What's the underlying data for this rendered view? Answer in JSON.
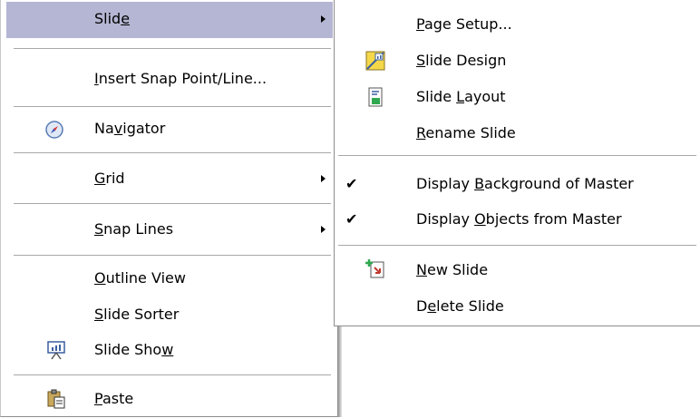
{
  "context_menu": {
    "items": [
      {
        "pre": "Slid",
        "key": "e",
        "post": "",
        "has_submenu": true
      },
      {
        "pre": "",
        "key": "I",
        "post": "nsert Snap Point/Line..."
      },
      {
        "pre": "Na",
        "key": "v",
        "post": "igator",
        "icon": "navigator-compass-icon"
      },
      {
        "pre": "",
        "key": "G",
        "post": "rid",
        "has_submenu": true
      },
      {
        "pre": "",
        "key": "S",
        "post": "nap Lines",
        "has_submenu": true
      },
      {
        "pre": "",
        "key": "O",
        "post": "utline View"
      },
      {
        "pre": "",
        "key": "S",
        "post": "lide Sorter"
      },
      {
        "pre": "Slide Sho",
        "key": "w",
        "post": "",
        "icon": "slide-show-icon"
      },
      {
        "pre": "",
        "key": "P",
        "post": "aste",
        "icon": "paste-icon"
      }
    ]
  },
  "submenu": {
    "items": [
      {
        "pre": "",
        "key": "P",
        "post": "age Setup..."
      },
      {
        "pre": "",
        "key": "S",
        "post": "lide Design",
        "icon": "slide-design-icon"
      },
      {
        "pre": "Slide ",
        "key": "L",
        "post": "ayout",
        "icon": "slide-layout-icon"
      },
      {
        "pre": "",
        "key": "R",
        "post": "ename Slide"
      },
      {
        "pre": "Display ",
        "key": "B",
        "post": "ackground of Master",
        "checked": true
      },
      {
        "pre": "Display ",
        "key": "O",
        "post": "bjects from Master",
        "checked": true
      },
      {
        "pre": "",
        "key": "N",
        "post": "ew Slide",
        "icon": "new-slide-icon"
      },
      {
        "pre": "D",
        "key": "e",
        "post": "lete Slide"
      }
    ],
    "check_glyph": "✔"
  },
  "colors": {
    "highlight": "#b5b6d3",
    "separator": "#a8a8a8"
  }
}
